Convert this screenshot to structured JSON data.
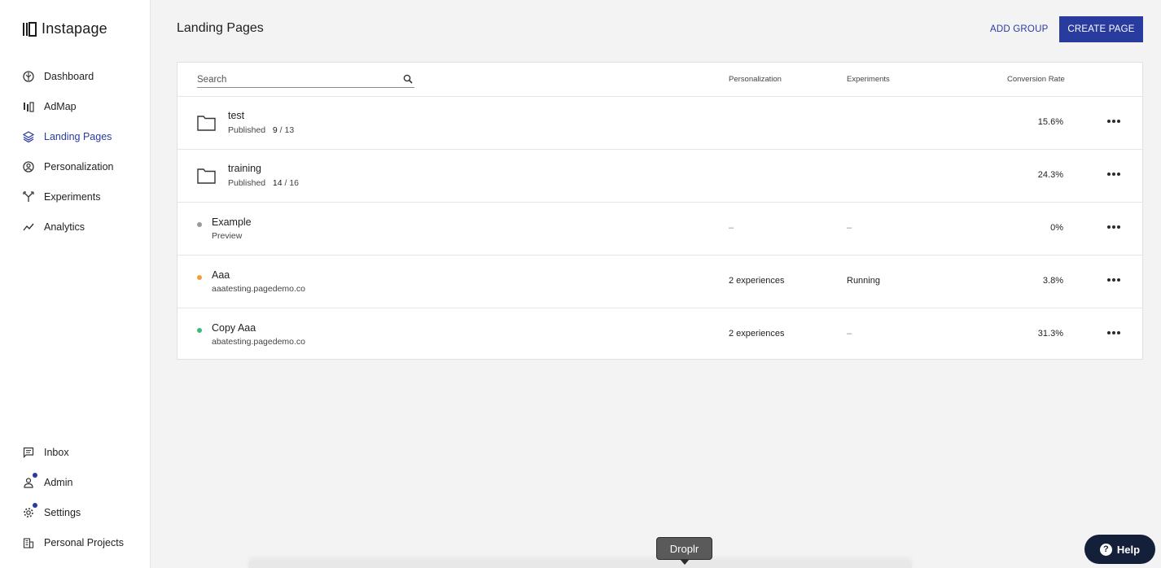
{
  "app": {
    "name": "Instapage"
  },
  "sidebar": {
    "top_items": [
      {
        "label": "Dashboard",
        "icon": "dashboard-icon"
      },
      {
        "label": "AdMap",
        "icon": "admap-icon"
      },
      {
        "label": "Landing Pages",
        "icon": "layers-icon",
        "active": true
      },
      {
        "label": "Personalization",
        "icon": "person-circle-icon"
      },
      {
        "label": "Experiments",
        "icon": "split-arrow-icon"
      },
      {
        "label": "Analytics",
        "icon": "trend-line-icon"
      }
    ],
    "bottom_items": [
      {
        "label": "Inbox",
        "icon": "inbox-icon"
      },
      {
        "label": "Admin",
        "icon": "admin-icon",
        "badge": true
      },
      {
        "label": "Settings",
        "icon": "gear-icon",
        "badge": true
      },
      {
        "label": "Personal Projects",
        "icon": "building-icon"
      }
    ]
  },
  "header": {
    "title": "Landing Pages",
    "add_group_label": "ADD GROUP",
    "create_page_label": "CREATE PAGE"
  },
  "table": {
    "search_placeholder": "Search",
    "columns": {
      "personalization": "Personalization",
      "experiments": "Experiments",
      "conversion_rate": "Conversion Rate"
    },
    "groups": [
      {
        "name": "test",
        "status_label": "Published",
        "published": "9",
        "total": "/ 13",
        "rate": "15.6%"
      },
      {
        "name": "training",
        "status_label": "Published",
        "published": "14",
        "total": "/ 16",
        "rate": "24.3%"
      }
    ],
    "pages": [
      {
        "name": "Example",
        "sub": "Preview",
        "status_color": "#9a9a9a",
        "personalization": "–",
        "experiments": "–",
        "rate": "0%"
      },
      {
        "name": "Aaa",
        "sub": "aaatesting.pagedemo.co",
        "status_color": "#f0a030",
        "personalization": "2 experiences",
        "experiments": "Running",
        "rate": "3.8%"
      },
      {
        "name": "Copy Aaa",
        "sub": "abatesting.pagedemo.co",
        "status_color": "#3dbb78",
        "personalization": "2 experiences",
        "experiments": "–",
        "rate": "31.3%"
      }
    ]
  },
  "overlay": {
    "tooltip": "Droplr",
    "help_label": "Help"
  },
  "colors": {
    "accent": "#2a3ba0",
    "help_bg": "#14203a"
  }
}
